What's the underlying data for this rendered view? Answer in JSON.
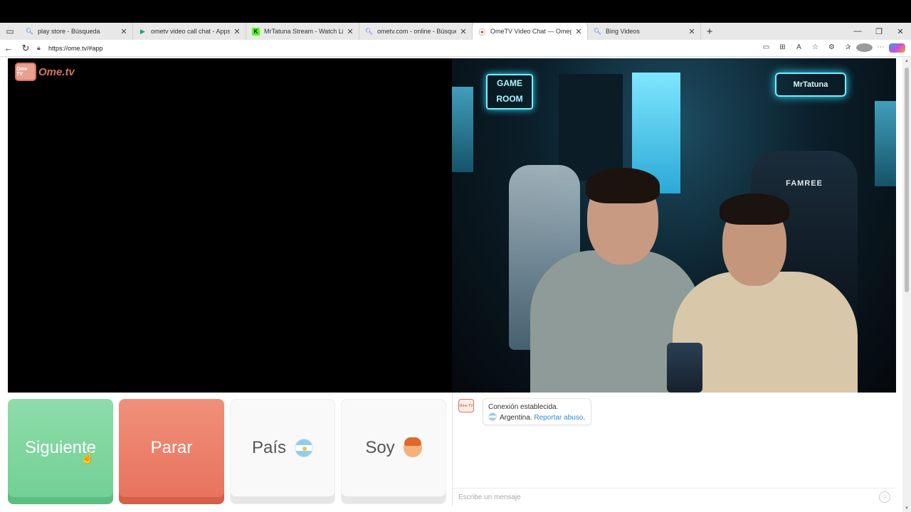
{
  "browser": {
    "tabs": [
      {
        "label": "play store - Búsqueda",
        "icon": "search-icon",
        "active": false
      },
      {
        "label": "ometv video call chat - Apps de A",
        "icon": "play-store-icon",
        "active": false
      },
      {
        "label": "MrTatuna Stream - Watch Live on",
        "icon": "kick-icon",
        "active": false
      },
      {
        "label": "ometv.com - online - Búsqueda",
        "icon": "search-icon",
        "active": false
      },
      {
        "label": "OmeTV Video Chat — Omeg",
        "icon": "record-icon",
        "active": true
      },
      {
        "label": "Bing Videos",
        "icon": "search-icon",
        "active": false
      }
    ],
    "new_tab": "+",
    "url": "https://ome.tv/#app",
    "window_controls": {
      "minimize": "—",
      "restore": "❐",
      "close": "✕"
    }
  },
  "app": {
    "logo_text": "Ome.tv",
    "logo_badge": "Ome TV",
    "webcam": {
      "game_room_sign": "GAME ROOM",
      "brand_sign": "MrTatuna",
      "chair_brand": "FAMREE"
    },
    "buttons": {
      "next": "Siguiente",
      "stop": "Parar",
      "country": "País",
      "gender": "Soy"
    },
    "chat": {
      "avatar_text": "Ome TV",
      "status": "Conexión establecida.",
      "country": "Argentina.",
      "report": "Reportar abuso",
      "report_suffix": ".",
      "input_placeholder": "Escribe un mensaje"
    }
  },
  "colors": {
    "next_button": "#7ad69c",
    "stop_button": "#ea7a64",
    "logo_accent": "#d4735f",
    "link": "#2b8fd8"
  }
}
